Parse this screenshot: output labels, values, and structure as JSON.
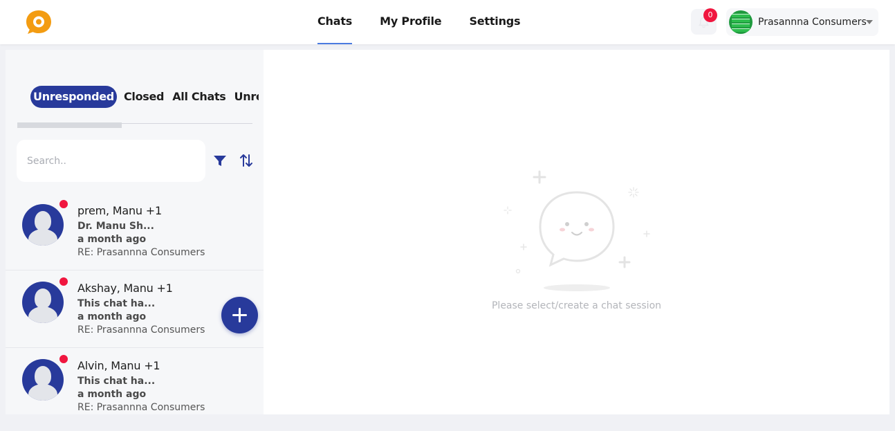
{
  "app": {
    "logo_icon": "chat-bubble-logo-icon",
    "brand_color": "#f39c12",
    "accent": "#283a9b",
    "badge_color": "#f0163f"
  },
  "nav": {
    "items": [
      {
        "label": "Chats",
        "active": true
      },
      {
        "label": "My Profile",
        "active": false
      },
      {
        "label": "Settings",
        "active": false
      }
    ]
  },
  "notifications": {
    "icon": "bell-icon",
    "count": "0"
  },
  "account": {
    "name": "Prasannna Consumers",
    "icon": "chevron-down-icon"
  },
  "tabs": {
    "items": [
      {
        "label": "Unresponded",
        "active": true
      },
      {
        "label": "Closed",
        "active": false
      },
      {
        "label": "All Chats",
        "active": false
      },
      {
        "label": "Unread",
        "active": false
      }
    ]
  },
  "search": {
    "placeholder": "Search..",
    "value": ""
  },
  "toolbar": {
    "filter_icon": "filter-icon",
    "sort_icon": "sort-icon"
  },
  "chats": [
    {
      "name": "prem, Manu +1",
      "preview": "Dr. Manu Sh...",
      "time": "a month ago",
      "subject": "RE: Prasannna Consumers",
      "unread": true
    },
    {
      "name": "Akshay, Manu +1",
      "preview": "This chat ha...",
      "time": "a month ago",
      "subject": "RE: Prasannna Consumers",
      "unread": true
    },
    {
      "name": "Alvin, Manu +1",
      "preview": "This chat ha...",
      "time": "a month ago",
      "subject": "RE: Prasannna Consumers",
      "unread": true
    }
  ],
  "fab": {
    "icon": "plus-icon"
  },
  "empty_state": {
    "illustration": "smiling-chat-bubble-illustration",
    "message": "Please select/create a chat session"
  }
}
